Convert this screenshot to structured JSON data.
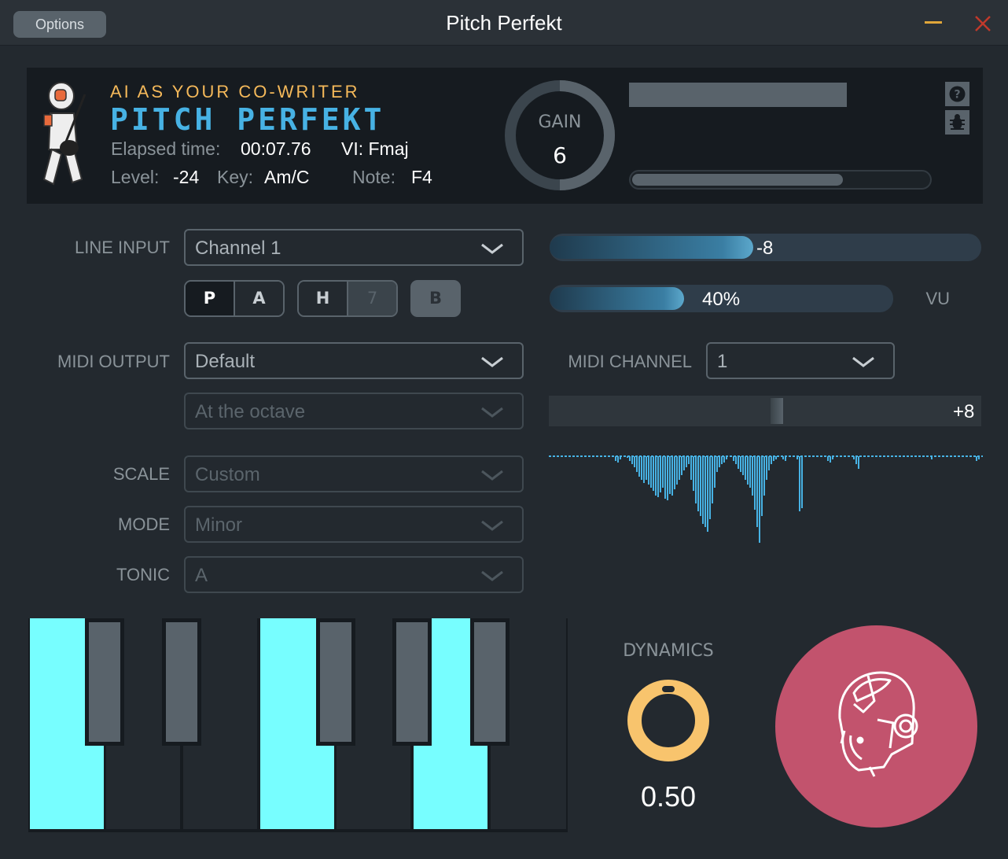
{
  "window": {
    "title": "Pitch Perfekt",
    "options_label": "Options"
  },
  "header": {
    "tagline": "AI AS YOUR CO-WRITER",
    "brand": "PITCH PERFEKT",
    "elapsed_label": "Elapsed time:",
    "elapsed_value": "00:07.76",
    "vi_value": "VI: Fmaj",
    "level_label": "Level:",
    "level_value": "-24",
    "key_label": "Key:",
    "key_value": "Am/C",
    "note_label": "Note:",
    "note_value": "F4",
    "gain_label": "GAIN",
    "gain_value": "6",
    "progress_fraction": 0.71
  },
  "input": {
    "line_input_label": "LINE INPUT",
    "line_input_value": "Channel 1",
    "line_level_value": "-8",
    "buttons": {
      "p": "P",
      "a": "A",
      "h": "H",
      "seven": "7",
      "b": "B"
    },
    "percent_value": "40%",
    "vu_label": "VU"
  },
  "midi": {
    "output_label": "MIDI OUTPUT",
    "output_value": "Default",
    "octave_value": "At the octave",
    "channel_label": "MIDI CHANNEL",
    "channel_value": "1",
    "pitch_value": "+8"
  },
  "scale": {
    "scale_label": "SCALE",
    "scale_value": "Custom",
    "mode_label": "MODE",
    "mode_value": "Minor",
    "tonic_label": "TONIC",
    "tonic_value": "A"
  },
  "dynamics": {
    "label": "DYNAMICS",
    "value": "0.50"
  },
  "colors": {
    "accent": "#47b2e4",
    "tagline": "#f5b95a",
    "key_active": "#77feff",
    "record": "#c2536d",
    "knob": "#f8c46d"
  }
}
